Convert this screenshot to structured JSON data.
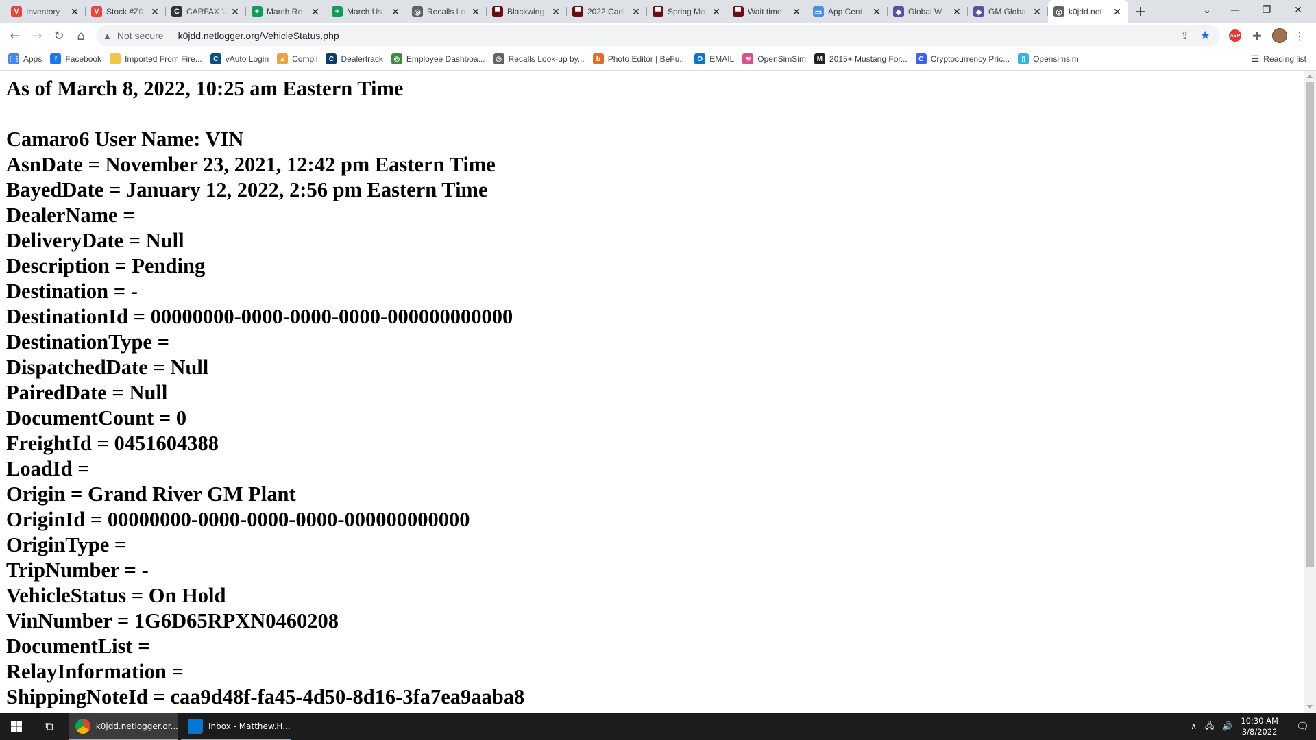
{
  "browser": {
    "tabs": [
      {
        "title": "Inventory",
        "icon": "vauto-icon",
        "color": "#e8453c",
        "letter": "V"
      },
      {
        "title": "Stock #Z0",
        "icon": "vauto-icon",
        "color": "#e8453c",
        "letter": "V"
      },
      {
        "title": "CARFAX V",
        "icon": "carfax-icon",
        "color": "#333333",
        "letter": "C"
      },
      {
        "title": "March Re",
        "icon": "sheets-icon",
        "color": "#0f9d58",
        "letter": "+"
      },
      {
        "title": "March Us",
        "icon": "sheets-icon",
        "color": "#0f9d58",
        "letter": "+"
      },
      {
        "title": "Recalls Lo",
        "icon": "globe-icon",
        "color": "#5f6368",
        "letter": "◎"
      },
      {
        "title": "Blackwing",
        "icon": "cadillac-icon",
        "color": "#6b1010",
        "letter": "▀"
      },
      {
        "title": "2022 Cadi",
        "icon": "cadillac-icon",
        "color": "#6b1010",
        "letter": "▀"
      },
      {
        "title": "Spring Mo",
        "icon": "cadillac-icon",
        "color": "#6b1010",
        "letter": "▀"
      },
      {
        "title": "Wait time",
        "icon": "cadillac-icon",
        "color": "#6b1010",
        "letter": "▀"
      },
      {
        "title": "App Cent",
        "icon": "app-center-icon",
        "color": "#4a90e2",
        "letter": "▭"
      },
      {
        "title": "Global W",
        "icon": "gm-diamond-icon",
        "color": "#5b4fa8",
        "letter": "◆"
      },
      {
        "title": "GM Globa",
        "icon": "gm-diamond-icon",
        "color": "#5b4fa8",
        "letter": "◆"
      },
      {
        "title": "k0jdd.net",
        "icon": "globe-icon",
        "color": "#5f6368",
        "letter": "◎",
        "active": true
      }
    ],
    "address": {
      "security_label": "Not secure",
      "url": "k0jdd.netlogger.org/VehicleStatus.php"
    },
    "bookmarks": [
      {
        "label": "Apps",
        "icon": "apps-grid-icon",
        "color": "#4285f4",
        "letter": "⋮⋮"
      },
      {
        "label": "Facebook",
        "icon": "facebook-icon",
        "color": "#1877f2",
        "letter": "f"
      },
      {
        "label": "Imported From Fire...",
        "icon": "folder-icon",
        "color": "#f4c542",
        "letter": ""
      },
      {
        "label": "vAuto Login",
        "icon": "vauto-login-icon",
        "color": "#0b4f8a",
        "letter": "C"
      },
      {
        "label": "Compli",
        "icon": "compli-icon",
        "color": "#f1a33b",
        "letter": "▲"
      },
      {
        "label": "Dealertrack",
        "icon": "dealertrack-icon",
        "color": "#0a3d6b",
        "letter": "C"
      },
      {
        "label": "Employee Dashboa...",
        "icon": "dashboard-icon",
        "color": "#3a8b3a",
        "letter": "◎"
      },
      {
        "label": "Recalls Look-up by...",
        "icon": "globe-icon",
        "color": "#5f6368",
        "letter": "◎"
      },
      {
        "label": "Photo Editor | BeFu...",
        "icon": "befunky-icon",
        "color": "#e66b1f",
        "letter": "b"
      },
      {
        "label": "EMAIL",
        "icon": "outlook-icon",
        "color": "#0078d4",
        "letter": "O"
      },
      {
        "label": "OpenSimSim",
        "icon": "opensim-icon",
        "color": "#e64a8a",
        "letter": "≋"
      },
      {
        "label": "2015+ Mustang For...",
        "icon": "mustang-icon",
        "color": "#222222",
        "letter": "M"
      },
      {
        "label": "Cryptocurrency Pric...",
        "icon": "crypto-icon",
        "color": "#3861fb",
        "letter": "C"
      },
      {
        "label": "Opensimsim",
        "icon": "page-icon",
        "color": "#2bb5e8",
        "letter": "▯"
      }
    ],
    "reading_list_label": "Reading list"
  },
  "page": {
    "lines": [
      "As of March 8, 2022, 10:25 am Eastern Time",
      "",
      "Camaro6 User Name: VIN",
      "AsnDate = November 23, 2021, 12:42 pm Eastern Time",
      "BayedDate = January 12, 2022, 2:56 pm Eastern Time",
      "DealerName =",
      "DeliveryDate = Null",
      "Description = Pending",
      "Destination = -",
      "DestinationId = 00000000-0000-0000-0000-000000000000",
      "DestinationType =",
      "DispatchedDate = Null",
      "PairedDate = Null",
      "DocumentCount = 0",
      "FreightId = 0451604388",
      "LoadId =",
      "Origin = Grand River GM Plant",
      "OriginId = 00000000-0000-0000-0000-000000000000",
      "OriginType =",
      "TripNumber = -",
      "VehicleStatus = On Hold",
      "VinNumber = 1G6D65RPXN0460208",
      "DocumentList =",
      "RelayInformation =",
      "ShippingNoteId = caa9d48f-fa45-4d50-8d16-3fa7ea9aaba8"
    ]
  },
  "taskbar": {
    "apps": [
      {
        "label": "k0jdd.netlogger.or...",
        "icon": "chrome-icon",
        "active": true
      },
      {
        "label": "Inbox - Matthew.H...",
        "icon": "outlook-icon",
        "active": false
      }
    ],
    "time": "10:30 AM",
    "date": "3/8/2022"
  },
  "colors": {
    "tabstrip": "#dee1e6",
    "taskbar": "#1c1c1c",
    "accent": "#1a73e8"
  }
}
